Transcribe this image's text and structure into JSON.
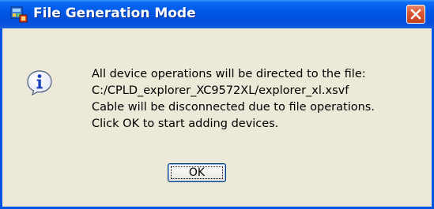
{
  "window": {
    "title": "File Generation Mode",
    "app_icon": "app-icon",
    "close_icon": "close-icon"
  },
  "dialog": {
    "icon": "info-icon",
    "message_lines": [
      "All device operations will be directed to the file:",
      "C:/CPLD_explorer_XC9572XL/explorer_xl.xsvf",
      "Cable will be disconnected due to file operations.",
      "Click OK to start adding devices."
    ],
    "ok_label": "OK"
  },
  "colors": {
    "titlebar": "#0058e6",
    "window_body": "#ece9d8",
    "close_button": "#d9542f",
    "info_icon_blue": "#1a3fbf"
  }
}
